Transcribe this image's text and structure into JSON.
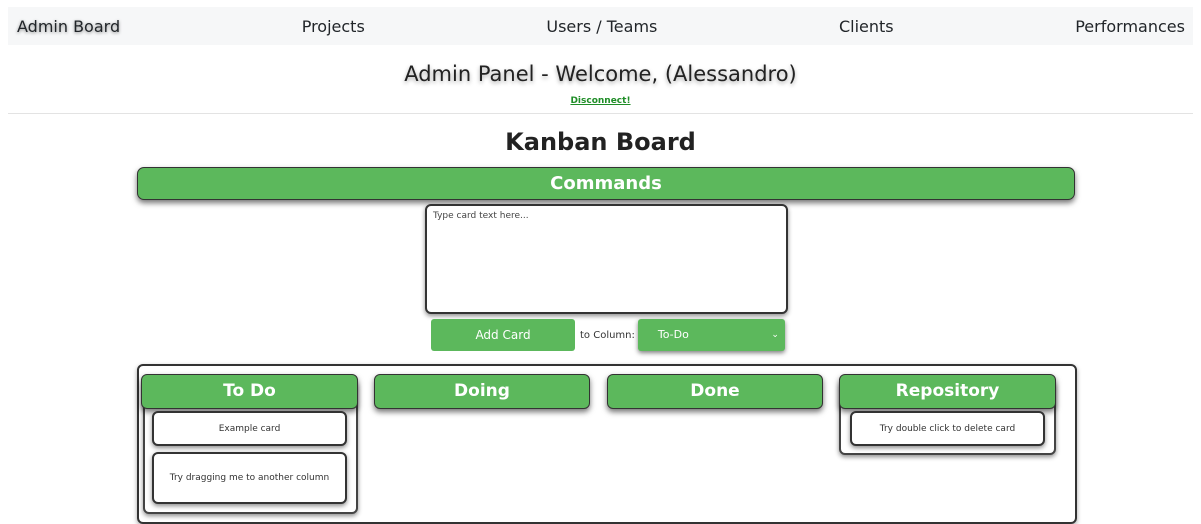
{
  "nav": {
    "items": [
      {
        "label": "Admin Board"
      },
      {
        "label": "Projects"
      },
      {
        "label": "Users / Teams"
      },
      {
        "label": "Clients"
      },
      {
        "label": "Performances"
      }
    ]
  },
  "header": {
    "welcome": "Admin Panel - Welcome, (Alessandro)",
    "disconnect": "Disconnect!"
  },
  "board": {
    "title": "Kanban Board",
    "commands_label": "Commands",
    "textarea_placeholder": "Type card text here...",
    "add_card_label": "Add Card",
    "to_column_label": "to Column:",
    "selected_column": "To-Do"
  },
  "columns": [
    {
      "title": "To Do",
      "cards": [
        "Example card",
        "Try dragging me to another column"
      ]
    },
    {
      "title": "Doing",
      "cards": []
    },
    {
      "title": "Done",
      "cards": []
    },
    {
      "title": "Repository",
      "cards": [
        "Try double click to delete card"
      ]
    }
  ],
  "colors": {
    "accent_green": "#5cb85c",
    "link_green": "#1f8d27",
    "nav_background": "#f6f7f8"
  },
  "icons": {
    "select_chevron": "chevron-down-icon"
  }
}
